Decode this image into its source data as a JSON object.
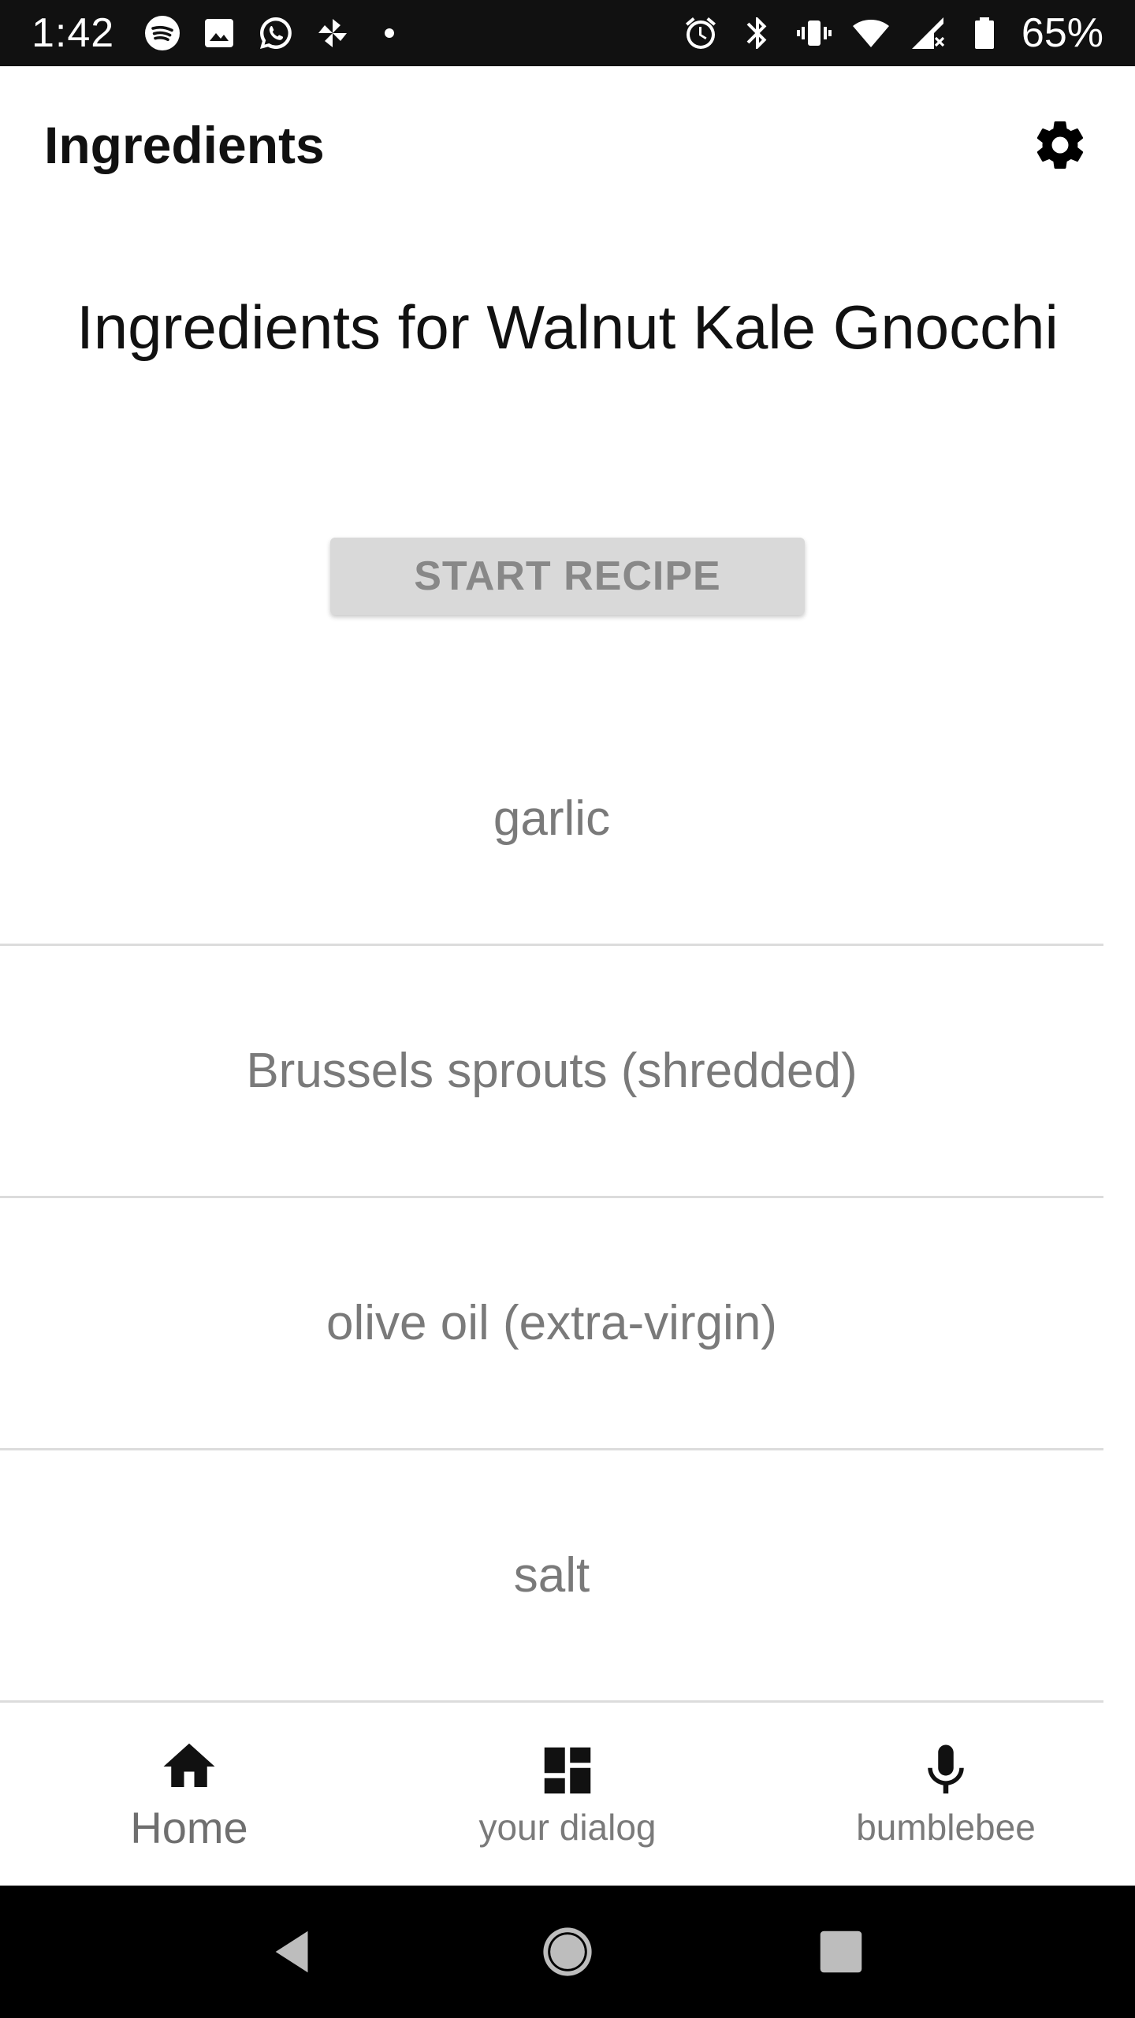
{
  "status_bar": {
    "time": "1:42",
    "battery_percent": "65%",
    "left_icons": [
      "spotify-icon",
      "image-icon",
      "whatsapp-icon",
      "pinwheel-icon",
      "dot-icon"
    ],
    "right_icons": [
      "alarm-icon",
      "bluetooth-icon",
      "vibrate-icon",
      "wifi-icon",
      "signal-icon",
      "battery-icon"
    ]
  },
  "app_bar": {
    "title": "Ingredients",
    "settings_icon": "gear-icon"
  },
  "recipe": {
    "heading": "Ingredients for Walnut Kale Gnocchi",
    "start_button_label": "START RECIPE"
  },
  "ingredients": [
    "garlic",
    "Brussels sprouts (shredded)",
    "olive oil (extra-virgin)",
    "salt"
  ],
  "bottom_nav": {
    "items": [
      {
        "label": "Home",
        "icon": "home-icon",
        "active": true
      },
      {
        "label": "your dialog",
        "icon": "dashboard-icon",
        "active": false
      },
      {
        "label": "bumblebee",
        "icon": "microphone-icon",
        "active": false
      }
    ]
  },
  "system_nav": {
    "buttons": [
      "back-icon",
      "home-circle-icon",
      "recents-icon"
    ]
  },
  "colors": {
    "status_bar_bg": "#111111",
    "button_bg": "#d9d9d9",
    "button_text": "#888888",
    "list_text": "#7a7a7a",
    "divider": "#dcdcdc"
  }
}
